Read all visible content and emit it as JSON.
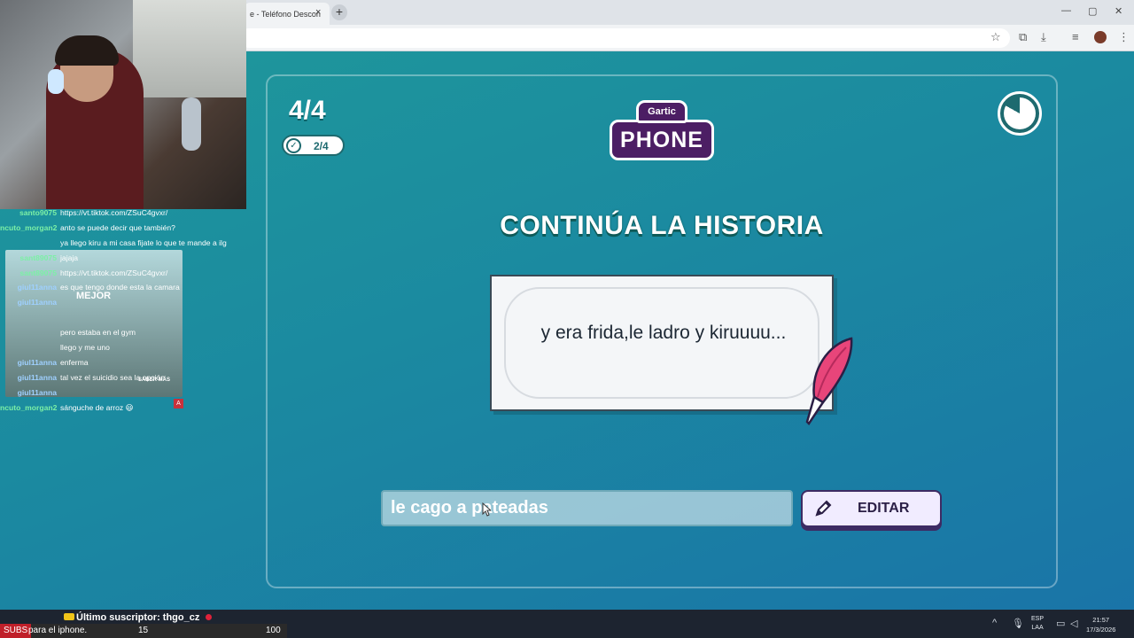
{
  "browser": {
    "tab_title": "e - Teléfono Descon",
    "tab_close": "×",
    "new_tab": "+",
    "window_controls": [
      "—",
      "▢",
      "✕"
    ],
    "toolbar_icons": [
      "star-icon",
      "translate-icon",
      "download-icon",
      "media-icon",
      "profile-icon",
      "menu-icon"
    ]
  },
  "stream": {
    "chat": [
      {
        "user": "santo9075",
        "msg": "https://vt.tiktok.com/ZSuC4gvxr/"
      },
      {
        "user": "ncuto_morgan2",
        "msg": "anto se puede decir que también?"
      },
      {
        "user": "",
        "msg": "ya llego kiru a mi casa fijate lo que te mande a ilg"
      },
      {
        "user": "sant89075",
        "msg": "jajaja"
      },
      {
        "user": "sant89075",
        "msg": "https://vt.tiktok.com/ZSuC4gvxr/"
      },
      {
        "user": "giul11anna",
        "msg": "es que tengo donde esta la camara"
      },
      {
        "user": "giul11anna",
        "msg": ""
      },
      {
        "user": "",
        "msg": ""
      },
      {
        "user": "",
        "msg": "pero estaba en el gym"
      },
      {
        "user": "",
        "msg": "llego y me uno"
      },
      {
        "user": "giul11anna",
        "msg": "enferma"
      },
      {
        "user": "giul11anna",
        "msg": "tal vez el suicidio sea la opción"
      },
      {
        "user": "giul11anna",
        "msg": ""
      },
      {
        "user": "ncuto_morgan2",
        "msg": "sánguche de arroz 😃"
      }
    ],
    "ad_label": "MEJOR",
    "ad_more": "SABER MÁS",
    "ad_badge": "A",
    "latest_subscriber": "Último suscriptor: thgo_cz",
    "subs_tag": "SUBS",
    "subs_text": "para el iphone.",
    "subs_count": "15",
    "subs_goal": "100"
  },
  "game": {
    "round": "4/4",
    "done_count": "2/4",
    "logo_top": "Gartic",
    "logo_main": "PHONE",
    "heading": "CONTINÚA LA HISTORIA",
    "story_text": "y era frida,le ladro y kiruuuu...",
    "answer_value": "le cago a pateadas",
    "edit_label": "EDITAR",
    "timer_remaining": 0.83
  },
  "taskbar": {
    "lang_top": "ESP",
    "lang_bottom": "LAA",
    "time": "21:57",
    "date": "17/3/2026"
  },
  "colors": {
    "background_top": "#1f9a9a",
    "background_bottom": "#1a73a8",
    "logo_purple": "#4c1e64",
    "button_border": "#3d2b63"
  }
}
